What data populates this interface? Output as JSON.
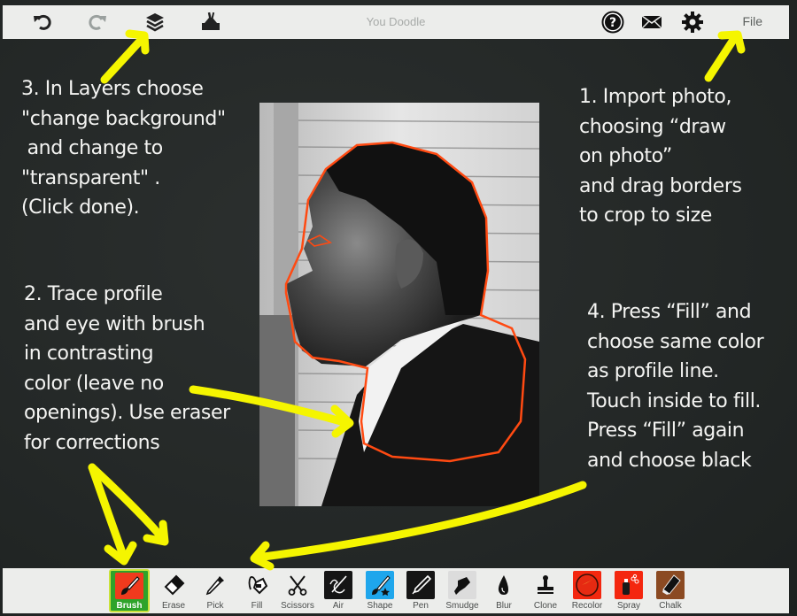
{
  "app": {
    "title": "You Doodle",
    "accent_color": "#ff4a12",
    "annotation_color": "#f5f500"
  },
  "topbar": {
    "undo_icon": "undo-icon",
    "redo_icon": "redo-icon",
    "layers_icon": "layers-icon",
    "clear_icon": "bucket-clear-icon",
    "help_icon": "help-icon",
    "mail_icon": "mail-icon",
    "settings_icon": "gear-icon",
    "file_label": "File"
  },
  "notes": {
    "step1": "1. Import photo,\nchoosing “draw\non photo”\nand drag borders\nto crop to size",
    "step2": "2. Trace profile\nand eye with brush\nin contrasting\ncolor (leave no\nopenings). Use eraser\nfor corrections",
    "step3": "3. In Layers choose\n\"change background\"\n and change to\n\"transparent\" .\n(Click done).",
    "step4": "4. Press “Fill” and\nchoose same color\nas profile line.\nTouch inside to fill.\nPress “Fill” again\nand choose black"
  },
  "photo": {
    "description": "Black and white profile photo with orange traced outline"
  },
  "tools": [
    {
      "label": "Brush",
      "icon": "brush-icon",
      "active": true
    },
    {
      "label": "Erase",
      "icon": "eraser-icon",
      "active": false
    },
    {
      "label": "Pick",
      "icon": "eyedropper-icon",
      "active": false
    },
    {
      "label": "Fill",
      "icon": "fill-bucket-icon",
      "active": false
    },
    {
      "label": "Scissors",
      "icon": "scissors-icon",
      "active": false
    },
    {
      "label": "Air",
      "icon": "airbrush-icon",
      "active": false
    },
    {
      "label": "Shape",
      "icon": "shape-icon",
      "active": false
    },
    {
      "label": "Pen",
      "icon": "pen-icon",
      "active": false
    },
    {
      "label": "Smudge",
      "icon": "smudge-icon",
      "active": false
    },
    {
      "label": "Blur",
      "icon": "blur-drop-icon",
      "active": false
    },
    {
      "label": "Clone",
      "icon": "clone-stamp-icon",
      "active": false
    },
    {
      "label": "Recolor",
      "icon": "recolor-icon",
      "active": false
    },
    {
      "label": "Spray",
      "icon": "spray-can-icon",
      "active": false
    },
    {
      "label": "Chalk",
      "icon": "chalk-icon",
      "active": false
    }
  ]
}
